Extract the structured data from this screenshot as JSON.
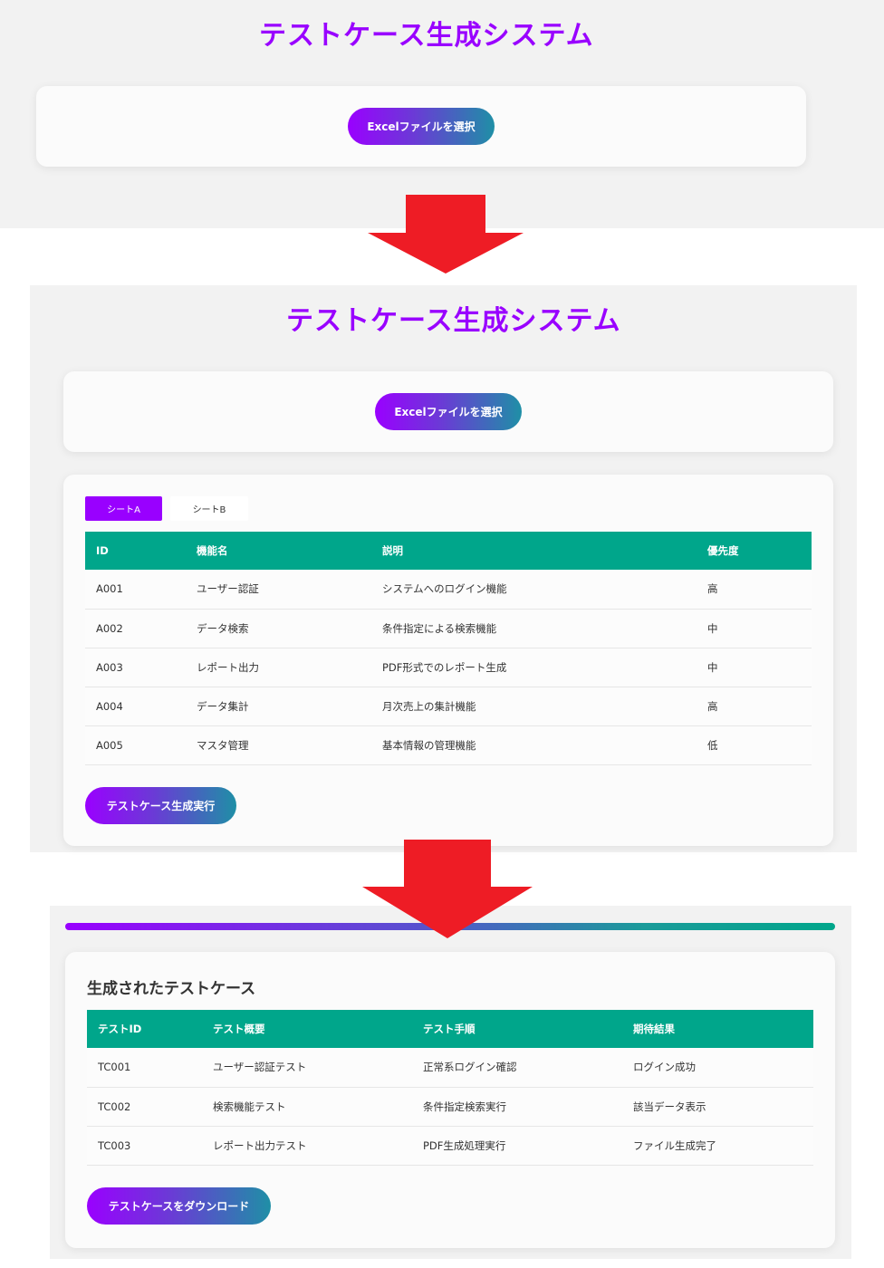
{
  "step1": {
    "title": "テストケース生成システム",
    "select_button": "Excelファイルを選択"
  },
  "step2": {
    "title": "テストケース生成システム",
    "select_button": "Excelファイルを選択",
    "tabs": [
      {
        "label": "シートA",
        "active": true
      },
      {
        "label": "シートB",
        "active": false
      }
    ],
    "table": {
      "headers": [
        "ID",
        "機能名",
        "説明",
        "優先度"
      ],
      "rows": [
        [
          "A001",
          "ユーザー認証",
          "システムへのログイン機能",
          "高"
        ],
        [
          "A002",
          "データ検索",
          "条件指定による検索機能",
          "中"
        ],
        [
          "A003",
          "レポート出力",
          "PDF形式でのレポート生成",
          "中"
        ],
        [
          "A004",
          "データ集計",
          "月次売上の集計機能",
          "高"
        ],
        [
          "A005",
          "マスタ管理",
          "基本情報の管理機能",
          "低"
        ]
      ]
    },
    "generate_button": "テストケース生成実行"
  },
  "step3": {
    "progress_percent": 100,
    "section_title": "生成されたテストケース",
    "table": {
      "headers": [
        "テストID",
        "テスト概要",
        "テスト手順",
        "期待結果"
      ],
      "rows": [
        [
          "TC001",
          "ユーザー認証テスト",
          "正常系ログイン確認",
          "ログイン成功"
        ],
        [
          "TC002",
          "検索機能テスト",
          "条件指定検索実行",
          "該当データ表示"
        ],
        [
          "TC003",
          "レポート出力テスト",
          "PDF生成処理実行",
          "ファイル生成完了"
        ]
      ]
    },
    "download_button": "テストケースをダウンロード"
  },
  "colors": {
    "title": "#9900ff",
    "table_header": "#00a68b",
    "arrow": "#ee1c25",
    "tab_active": "#9900ff"
  }
}
